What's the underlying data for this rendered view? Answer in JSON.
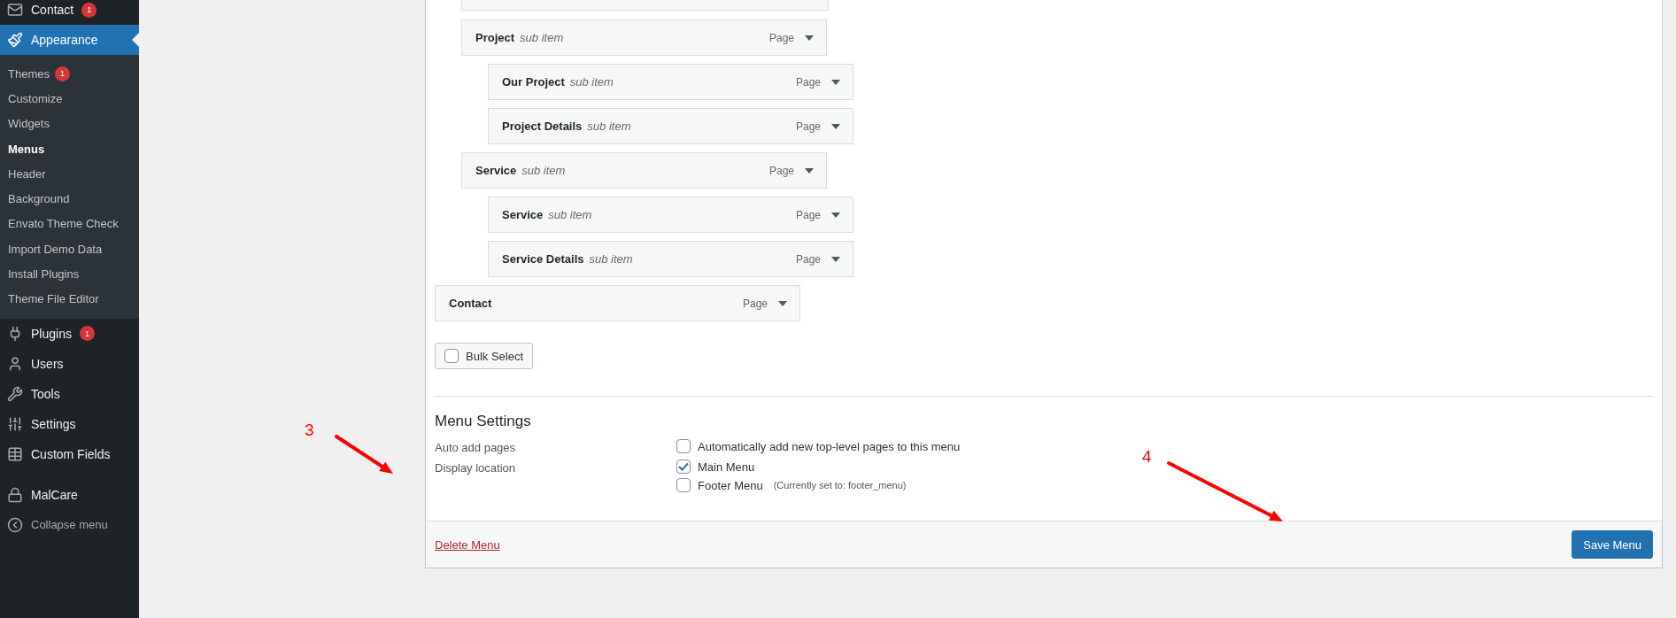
{
  "sidebar": {
    "items": [
      {
        "label": "Contact",
        "badge": "1",
        "selected": false
      },
      {
        "label": "Appearance",
        "selected": true,
        "expanded": true,
        "children": [
          {
            "label": "Themes",
            "badge": "1",
            "selected": false
          },
          {
            "label": "Customize",
            "selected": false
          },
          {
            "label": "Widgets",
            "selected": false
          },
          {
            "label": "Menus",
            "selected": true
          },
          {
            "label": "Header",
            "selected": false
          },
          {
            "label": "Background",
            "selected": false
          },
          {
            "label": "Envato Theme Check",
            "selected": false
          },
          {
            "label": "Import Demo Data",
            "selected": false
          },
          {
            "label": "Install Plugins",
            "selected": false
          },
          {
            "label": "Theme File Editor",
            "selected": false
          }
        ]
      },
      {
        "label": "Plugins",
        "badge": "1",
        "selected": false
      },
      {
        "label": "Users",
        "selected": false
      },
      {
        "label": "Tools",
        "selected": false
      },
      {
        "label": "Settings",
        "selected": false
      },
      {
        "label": "Custom Fields",
        "selected": false
      },
      {
        "label": "MalCare",
        "selected": false
      },
      {
        "label": "Collapse menu",
        "selected": false,
        "kind": "collapse"
      }
    ]
  },
  "menu_items": [
    {
      "title": "Project",
      "note": "sub item",
      "type": "Page",
      "children": [
        {
          "title": "Our Project",
          "note": "sub item",
          "type": "Page"
        },
        {
          "title": "Project Details",
          "note": "sub item",
          "type": "Page"
        }
      ]
    },
    {
      "title": "Service",
      "note": "sub item",
      "type": "Page",
      "children": [
        {
          "title": "Service",
          "note": "sub item",
          "type": "Page"
        },
        {
          "title": "Service Details",
          "note": "sub item",
          "type": "Page"
        }
      ]
    }
  ],
  "top_items": [
    {
      "title": "Contact",
      "type": "Page"
    }
  ],
  "bulk_select": {
    "label": "Bulk Select",
    "checked": false
  },
  "menu_settings": {
    "title": "Menu Settings",
    "rows": [
      {
        "label": "Auto add pages",
        "options": [
          {
            "label": "Automatically add new top-level pages to this menu",
            "checked": false
          }
        ]
      },
      {
        "label": "Display location",
        "options": [
          {
            "label": "Main Menu",
            "checked": true
          },
          {
            "label": "Footer Menu",
            "note": "(Currently set to: footer_menu)",
            "checked": false
          }
        ]
      }
    ]
  },
  "footer": {
    "delete": "Delete Menu",
    "save": "Save Menu"
  },
  "annotations": [
    {
      "label": "3"
    },
    {
      "label": "4"
    }
  ]
}
